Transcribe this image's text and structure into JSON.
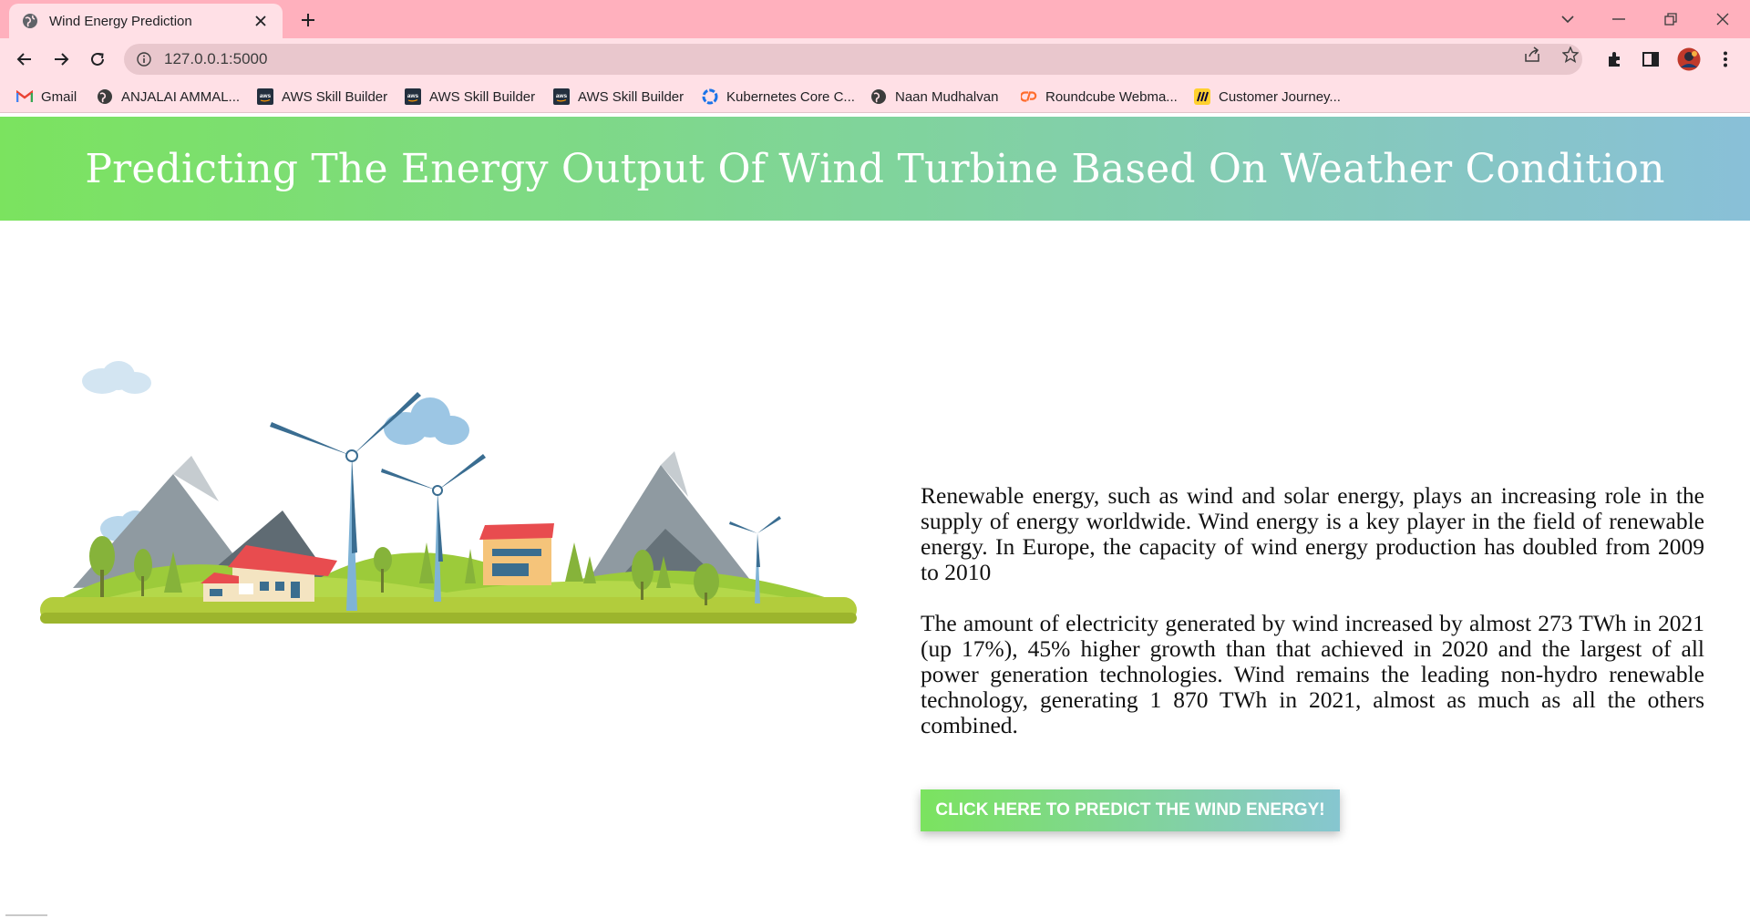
{
  "browser": {
    "tab": {
      "title": "Wind Energy Prediction"
    },
    "address_bar": {
      "url": "127.0.0.1:5000"
    },
    "bookmarks": [
      {
        "label": "Gmail",
        "icon": "gmail-icon"
      },
      {
        "label": "ANJALAI AMMAL...",
        "icon": "globe-icon"
      },
      {
        "label": "AWS Skill Builder",
        "icon": "aws-icon"
      },
      {
        "label": "AWS Skill Builder",
        "icon": "aws-icon"
      },
      {
        "label": "AWS Skill Builder",
        "icon": "aws-icon"
      },
      {
        "label": "Kubernetes Core C...",
        "icon": "kubernetes-icon"
      },
      {
        "label": "Naan Mudhalvan",
        "icon": "globe-icon"
      },
      {
        "label": "Roundcube Webma...",
        "icon": "cpanel-icon"
      },
      {
        "label": "Customer Journey...",
        "icon": "miro-icon"
      }
    ],
    "colors": {
      "tabstrip": "#ffb0bd",
      "toolbar": "#ffe0e6"
    }
  },
  "page": {
    "header_title": "Predicting The Energy Output Of Wind Turbine Based On Weather Condition",
    "paragraphs": [
      "Renewable energy, such as wind and solar energy, plays an increasing role in the supply of energy worldwide. Wind energy is a key player in the field of renewable energy. In Europe, the capacity of wind energy production has doubled from 2009 to 2010",
      "The amount of electricity generated by wind increased by almost 273 TWh in 2021 (up 17%), 45% higher growth than that achieved in 2020 and the largest of all power generation technologies. Wind remains the leading non-hydro renewable technology, generating 1 870 TWh in 2021, almost as much as all the others combined."
    ],
    "predict_button": "CLICK HERE TO PREDICT THE WIND ENERGY!",
    "colors": {
      "gradient_start": "#7be35f",
      "gradient_end": "#89c0d8"
    }
  }
}
